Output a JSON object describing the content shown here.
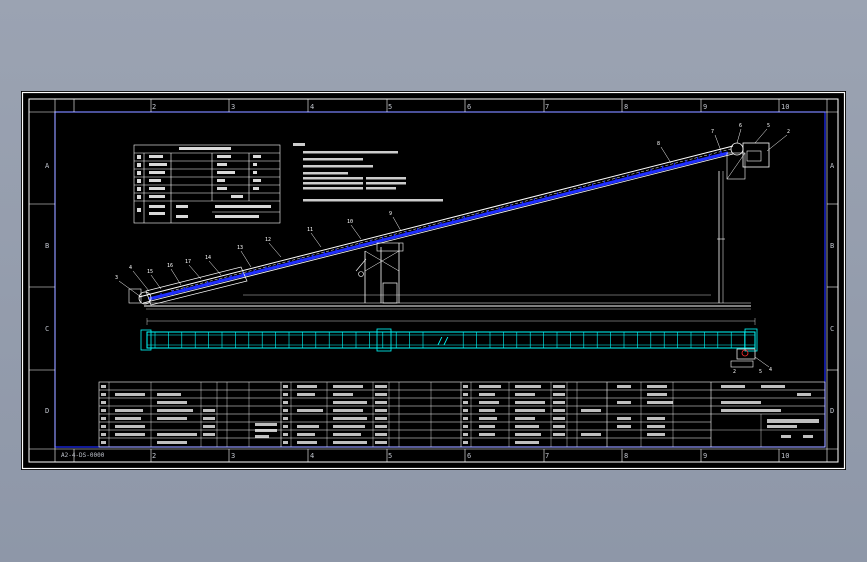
{
  "drawing": {
    "background": "#000000",
    "frame_color": "#ffffff",
    "accent_blue": "#1e2dff",
    "accent_cyan": "#00ffff",
    "accent_yellow": "#ffff00",
    "accent_red": "#ff3030",
    "zone_columns": [
      "2",
      "3",
      "4",
      "5",
      "6",
      "7",
      "8",
      "9",
      "10"
    ],
    "zone_rows": [
      "A",
      "B",
      "C",
      "D"
    ],
    "drawing_number": "A2-4-DS-0000",
    "plan_break_symbol": "//"
  }
}
